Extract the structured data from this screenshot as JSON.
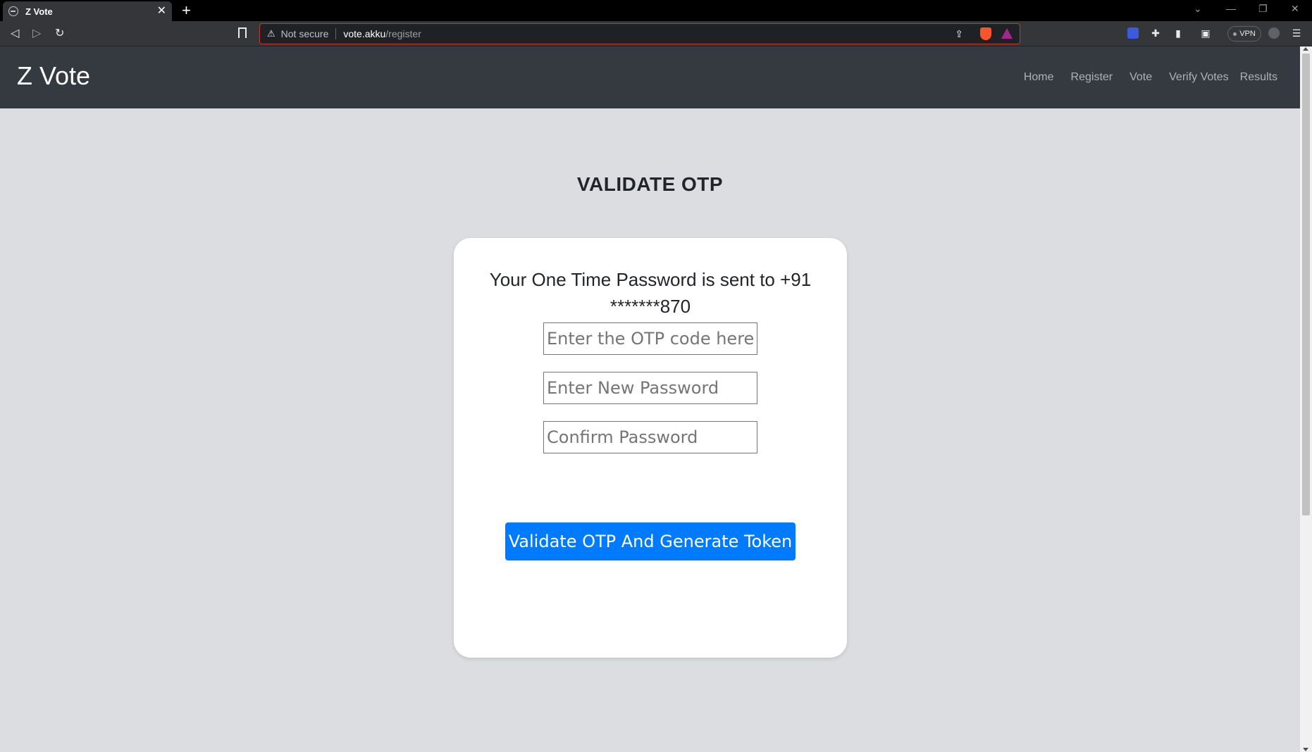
{
  "browser": {
    "tab_title": "Z Vote",
    "tab_close": "✕",
    "new_tab": "+",
    "security_label": "Not secure",
    "url_host": "vote.akku",
    "url_path": "/register",
    "vpn_label": "VPN"
  },
  "navbar": {
    "brand": "Z Vote",
    "links": [
      "Home",
      "Register",
      "Vote",
      "Verify Votes",
      "Results"
    ]
  },
  "page": {
    "heading": "VALIDATE OTP",
    "message": "Your One Time Password is sent to +91 *******870",
    "otp_placeholder": "Enter the OTP code here",
    "new_password_placeholder": "Enter New Password",
    "confirm_password_placeholder": "Confirm Password",
    "submit_label": "Validate OTP And Generate Token"
  },
  "colors": {
    "navbar_bg": "#343a40",
    "page_bg": "#dcdde1",
    "button_primary": "#007bff"
  }
}
